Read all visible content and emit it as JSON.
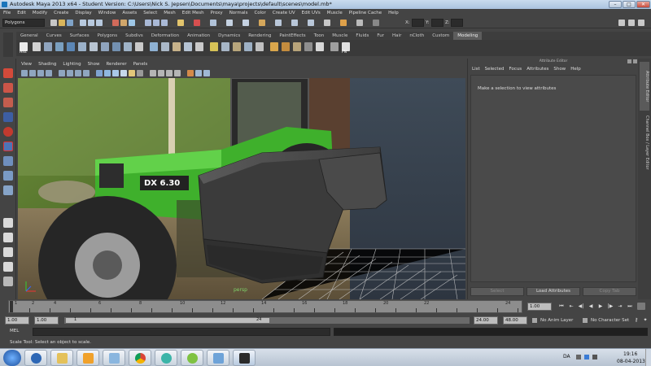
{
  "window": {
    "title": "Autodesk Maya 2013 x64 - Student Version: C:\\Users\\Nick S. Jepsen\\Documents\\maya\\projects\\default\\scenes\\model.mb*",
    "min": "–",
    "max": "□",
    "close": "✕"
  },
  "menu": [
    "File",
    "Edit",
    "Modify",
    "Create",
    "Display",
    "Window",
    "Assets",
    "Select",
    "Mesh",
    "Edit Mesh",
    "Proxy",
    "Normals",
    "Color",
    "Create UV",
    "Edit UVs",
    "Muscle",
    "Pipeline Cache",
    "Help"
  ],
  "status_line": {
    "mode": "Polygons",
    "x_label": "X:",
    "y_label": "Y:",
    "z_label": "Z:"
  },
  "shelf_tabs": [
    "General",
    "Curves",
    "Surfaces",
    "Polygons",
    "Subdivs",
    "Deformation",
    "Animation",
    "Dynamics",
    "Rendering",
    "PaintEffects",
    "Toon",
    "Muscle",
    "Fluids",
    "Fur",
    "Hair",
    "nCloth",
    "Custom",
    "Modeling"
  ],
  "shelf_active": "Modeling",
  "shelf_labels": {
    "first": "Hist",
    "last": "FN"
  },
  "viewport": {
    "menu": [
      "View",
      "Shading",
      "Lighting",
      "Show",
      "Renderer",
      "Panels"
    ],
    "camera_label": "persp",
    "image_plane_text": "DX 6.30"
  },
  "attribute_editor": {
    "title": "Attribute Editor",
    "menu": [
      "List",
      "Selected",
      "Focus",
      "Attributes",
      "Show",
      "Help"
    ],
    "message": "Make a selection to view attributes",
    "buttons": {
      "select": "Select",
      "load": "Load Attributes",
      "copy": "Copy Tab"
    }
  },
  "side_tabs": [
    "Attribute Editor",
    "Channel Box / Layer Editor"
  ],
  "time_slider": {
    "ticks": [
      "1",
      "2",
      "4",
      "6",
      "8",
      "10",
      "12",
      "14",
      "16",
      "18",
      "20",
      "22",
      "24"
    ],
    "current": "1.00"
  },
  "range": {
    "start": "1.00",
    "start2": "1.00",
    "slider_left": "1",
    "slider_right": "24",
    "end": "24.00",
    "end2": "48.00",
    "anim_layer": "No Anim Layer",
    "character_set": "No Character Set"
  },
  "command_line": {
    "label": "MEL"
  },
  "help_line": "Scale Tool: Select an object to scale.",
  "taskbar": {
    "language": "DA",
    "time": "19:16",
    "date": "08-04-2013",
    "apps": [
      "media-player-icon",
      "folder-icon",
      "video-player-icon",
      "chrome-icon",
      "download-icon",
      "spotify-icon",
      "explorer-icon",
      "maya-icon"
    ]
  },
  "colors": {
    "ui_bg": "#444444",
    "tractor_green": "#3fb02c",
    "active_tab": "#5d5d5d"
  }
}
